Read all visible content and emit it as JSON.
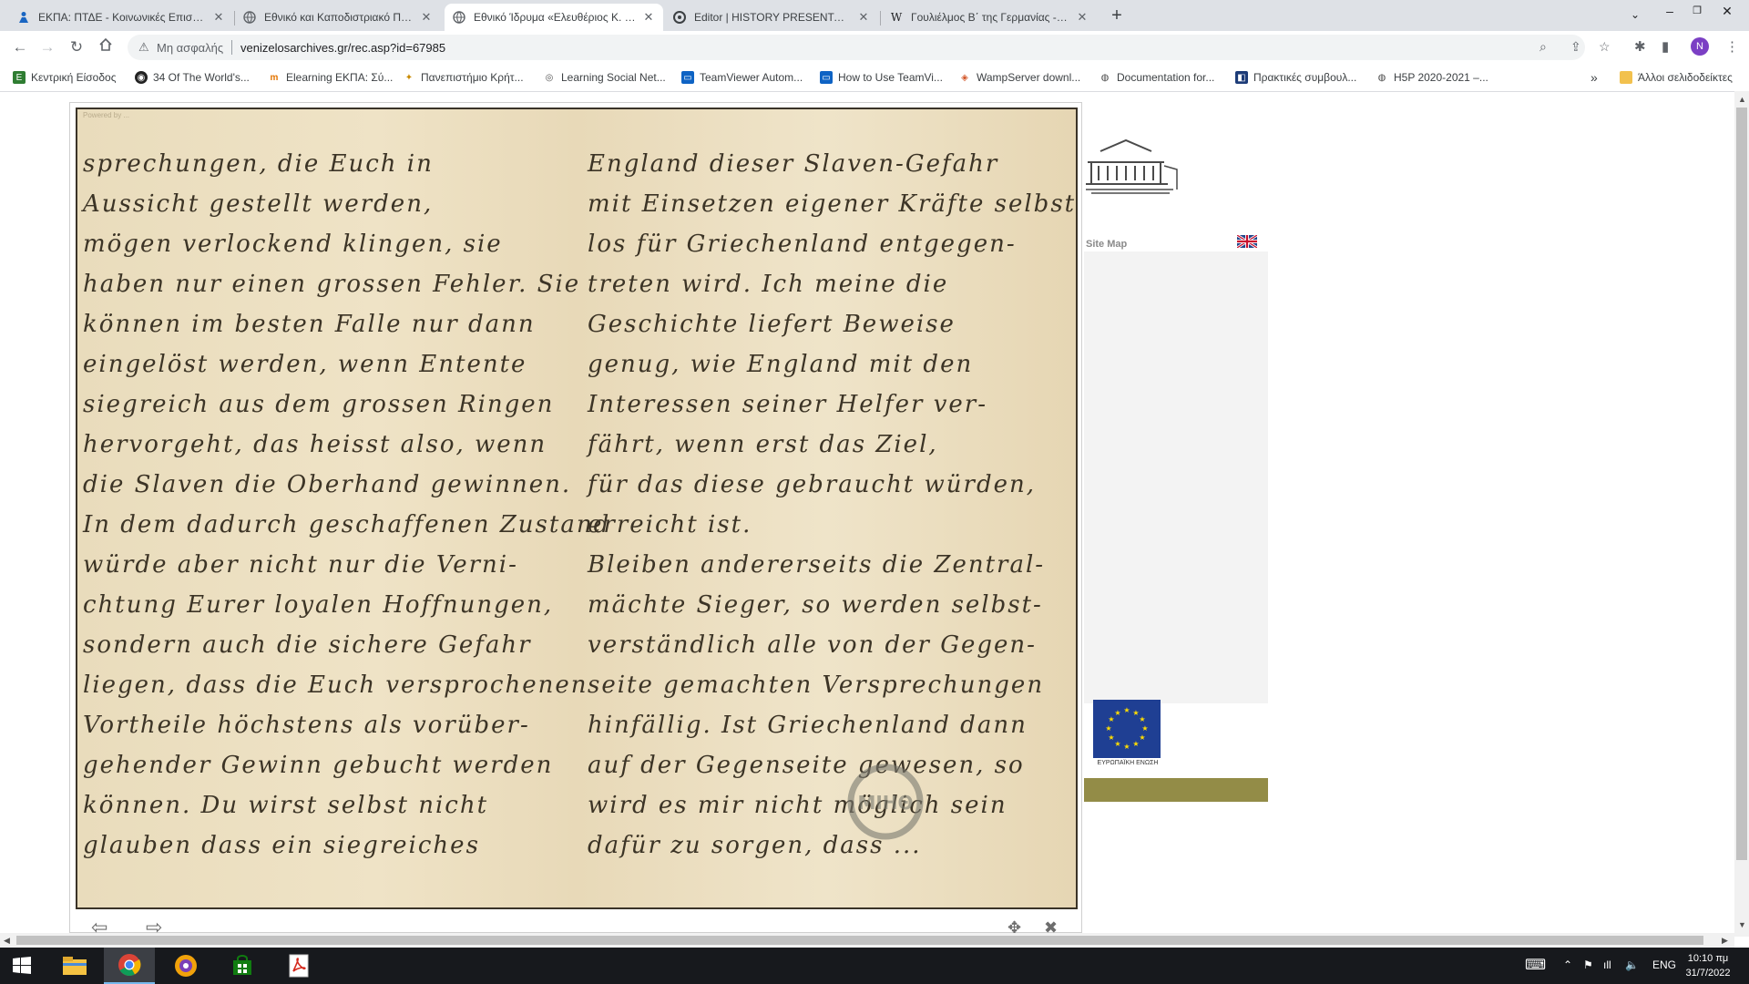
{
  "tabs": [
    {
      "title": "ΕΚΠΑ: ΠΤΔΕ - Κοινωνικές Επιστήμες",
      "icon": "person-icon"
    },
    {
      "title": "Εθνικό και Καποδιστριακό Πανεπιστήμιο",
      "icon": "globe-icon"
    },
    {
      "title": "Εθνικό Ίδρυμα «Ελευθέριος Κ. Βενιζέλος»",
      "icon": "globe-icon",
      "active": true
    },
    {
      "title": "Editor | HISTORY PRESENTATION",
      "icon": "editor-icon"
    },
    {
      "title": "Γουλιέλμος Β΄ της Γερμανίας - Βικιπαίδεια",
      "icon": "wikipedia-icon"
    }
  ],
  "omnibox": {
    "security_label": "Μη ασφαλής",
    "url": "venizelosarchives.gr/rec.asp?id=67985"
  },
  "profile_initial": "N",
  "bookmarks": [
    {
      "label": "Κεντρική Είσοδος",
      "color": "#2f7d32"
    },
    {
      "label": "34 Of The World's...",
      "color": "#222222"
    },
    {
      "label": "Elearning ΕΚΠΑ: Σύ...",
      "color": "#e37400"
    },
    {
      "label": "Πανεπιστήμιο Κρήτ...",
      "color": "#c98a00"
    },
    {
      "label": "Learning Social Net...",
      "color": "#555555"
    },
    {
      "label": "TeamViewer Autom...",
      "color": "#0e63c4"
    },
    {
      "label": "How to Use TeamVi...",
      "color": "#0e63c4"
    },
    {
      "label": "WampServer downl...",
      "color": "#d3572a"
    },
    {
      "label": "Documentation for...",
      "color": "#444444"
    },
    {
      "label": "Πρακτικές συμβουλ...",
      "color": "#1d3c78"
    },
    {
      "label": "H5P 2020-2021 –...",
      "color": "#444444"
    }
  ],
  "bookmarks_overflow": "»",
  "other_bookmarks": "Άλλοι σελιδοδείκτες",
  "document": {
    "powered_text": "Powered by ...",
    "left_column": [
      "sprechungen, die Euch in",
      "Aussicht gestellt werden,",
      "mögen verlockend klingen, sie",
      "haben nur einen grossen Fehler. Sie",
      "können im besten Falle nur dann",
      "eingelöst werden, wenn Entente",
      "siegreich aus dem grossen Ringen",
      "hervorgeht, das heisst also, wenn",
      "die Slaven die Oberhand gewinnen.",
      "In dem dadurch geschaffenen Zustand",
      "würde aber nicht nur die Verni-",
      "chtung Eurer loyalen Hoffnungen,",
      "sondern auch die sichere Gefahr",
      "liegen, dass die Euch versprochenen",
      "Vortheile höchstens als vorüber-",
      "gehender Gewinn gebucht werden",
      "können. Du wirst selbst nicht",
      "glauben dass ein siegreiches"
    ],
    "right_column": [
      "England dieser Slaven-Gefahr",
      "mit Einsetzen eigener Kräfte selbst-",
      "los für Griechenland entgegen-",
      "treten wird. Ich meine die",
      "Geschichte liefert Beweise",
      "genug, wie England mit den",
      "Interessen seiner Helfer ver-",
      "fährt, wenn erst das Ziel,",
      "für das diese gebraucht würden,",
      "erreicht ist.",
      "   Bleiben andererseits die Zentral-",
      "mächte Sieger, so werden selbst-",
      "verständlich alle von der Gegen-",
      "seite gemachten Versprechungen",
      "hinfällig. Ist Griechenland dann",
      "auf der Gegenseite gewesen, so",
      "wird es mir nicht möglich sein",
      "dafür zu sorgen, dass ..."
    ],
    "seal_text": "ΜΙΗΘ"
  },
  "side": {
    "sitemap_label": "Site Map",
    "eu_caption": "ΕΥΡΩΠΑΪΚΗ ΕΝΩΣΗ"
  },
  "taskbar": {
    "language": "ENG",
    "time": "10:10 πμ",
    "date": "31/7/2022"
  }
}
